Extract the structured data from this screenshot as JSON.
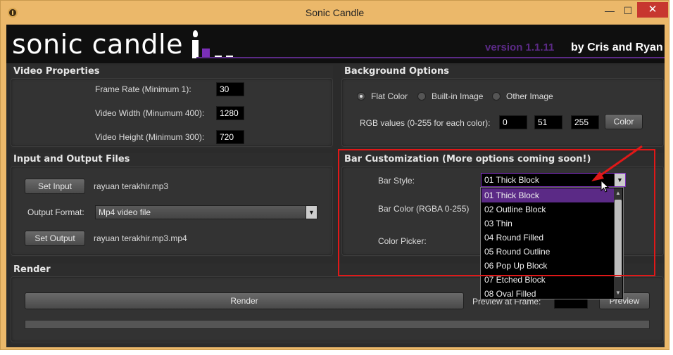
{
  "window": {
    "title": "Sonic Candle",
    "min_label": "—",
    "max_label": "☐",
    "close_label": "✕"
  },
  "header": {
    "logo_text": "sonic candle",
    "version": "version 1.1.11",
    "authors": "by Cris and Ryan"
  },
  "video_properties": {
    "title": "Video Properties",
    "frame_rate_label": "Frame Rate (Minimum 1):",
    "frame_rate": "30",
    "width_label": "Video Width (Minumum 400):",
    "width": "1280",
    "height_label": "Video Height (Minimum 300):",
    "height": "720"
  },
  "background_options": {
    "title": "Background Options",
    "radio_flat": "Flat Color",
    "radio_builtin": "Built-in Image",
    "radio_other": "Other Image",
    "selected": "Flat Color",
    "rgb_label": "RGB values (0-255 for each color):",
    "r": "0",
    "g": "51",
    "b": "255",
    "color_button": "Color"
  },
  "io_files": {
    "title": "Input and Output Files",
    "set_input_button": "Set Input",
    "input_file": "rayuan terakhir.mp3",
    "output_format_label": "Output Format:",
    "output_format": "Mp4 video file",
    "set_output_button": "Set Output",
    "output_file": "rayuan terakhir.mp3.mp4"
  },
  "bar_customization": {
    "title": "Bar Customization (More options coming soon!)",
    "bar_style_label": "Bar Style:",
    "bar_style_selected": "01 Thick Block",
    "bar_color_label": "Bar Color (RGBA 0-255)",
    "color_picker_label": "Color Picker:",
    "options": [
      "01 Thick Block",
      "02 Outline Block",
      "03 Thin",
      "04 Round Filled",
      "05 Round Outline",
      "06 Pop Up Block",
      "07 Etched Block",
      "08 Oval Filled"
    ]
  },
  "render": {
    "title": "Render",
    "render_button": "Render",
    "preview_label": "Preview at Frame:",
    "preview_button": "Preview",
    "progress": 0
  },
  "colors": {
    "accent_purple": "#5b2a86",
    "annotation_red": "#e01818",
    "title_bar": "#ebb86a"
  }
}
